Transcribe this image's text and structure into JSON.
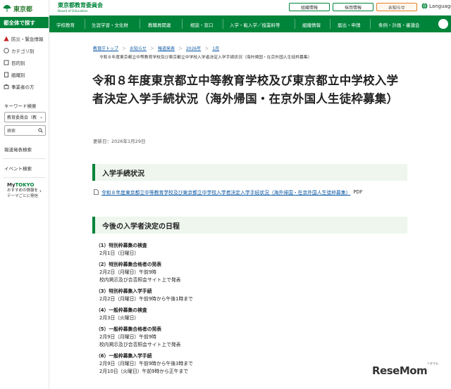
{
  "sidebar": {
    "logo_text": "東京都",
    "all_label": "都全体で探す",
    "items": [
      {
        "label": "防災・緊急情報",
        "icon": "warning-icon"
      },
      {
        "label": "カテゴリ別",
        "icon": "category-icon"
      },
      {
        "label": "目的別",
        "icon": "purpose-icon"
      },
      {
        "label": "組織別",
        "icon": "organization-icon"
      },
      {
        "label": "事業者の方",
        "icon": "business-icon"
      }
    ],
    "keyword_label": "キーワード検索",
    "scope_select": "教育委員会（教",
    "search_placeholder": "検索",
    "links": [
      "報道発表検索",
      "イベント検索"
    ],
    "mytokyo_prefix": "My",
    "mytokyo_name": "TOKYO",
    "mytokyo_desc_1": "おすすめの情報を",
    "mytokyo_desc_2": "テーマごとに発信"
  },
  "header": {
    "brand_name": "東京都教育委員会",
    "brand_sub": "Board of Education",
    "buttons": [
      "組織情報",
      "採用情報",
      "お知らせ"
    ],
    "language": "Language"
  },
  "nav": {
    "items": [
      "学校教育",
      "生涯学習・文化財",
      "教職員関連",
      "相談・窓口",
      "入学・転入学／授業料等",
      "組織情報",
      "届出・申請",
      "条例・計画・審議会"
    ]
  },
  "breadcrumb": {
    "items": [
      "教育庁トップ",
      "お知らせ",
      "報道発表",
      "2026年",
      "1月"
    ],
    "current": "令和８年度東京都立中等教育学校及び東京都立中学校入学者決定入学手続状況（海外帰国・在京外国人生徒枠募集）"
  },
  "page": {
    "title": "令和８年度東京都立中等教育学校及び東京都立中学校入学者決定入学手続状況（海外帰国・在京外国人生徒枠募集）",
    "updated": "更新日：2026年1月29日",
    "section1": "入学手続状況",
    "pdf_link": "令和８年度東京都立中等教育学校及び東京都立中学校入学者決定入学手続状況（海外帰国・在京外国人生徒枠募集）",
    "pdf_suffix": "PDF",
    "section2": "今後の入学者決定の日程"
  },
  "schedule": [
    {
      "head": "（1）特別枠募集の検査",
      "lines": [
        "2月1日（日曜日）"
      ]
    },
    {
      "head": "（2）特別枠募集合格者の発表",
      "lines": [
        "2月2日（月曜日）午前9時",
        "校内掲示及び合否照会サイト上で発表"
      ]
    },
    {
      "head": "（3）特別枠募集入学手続",
      "lines": [
        "2月2日（月曜日）午前9時から午後1時まで"
      ]
    },
    {
      "head": "（4）一般枠募集の検査",
      "lines": [
        "2月3日（火曜日）"
      ]
    },
    {
      "head": "（5）一般枠募集合格者の発表",
      "lines": [
        "2月9日（月曜日）午前9時",
        "校内掲示及び合否照会サイト上で発表"
      ]
    },
    {
      "head": "（6）一般枠募集入学手続",
      "lines": [
        "2月9日（月曜日）午前9時から午後3時まで",
        "2月10日（火曜日）午前9時から正午まで"
      ]
    }
  ],
  "watermark": {
    "text": "ReseMom",
    "sub": "リセマム"
  },
  "colors": {
    "brand_green": "#00843a",
    "link_blue": "#0b57a3",
    "notice_orange": "#e67e22"
  }
}
